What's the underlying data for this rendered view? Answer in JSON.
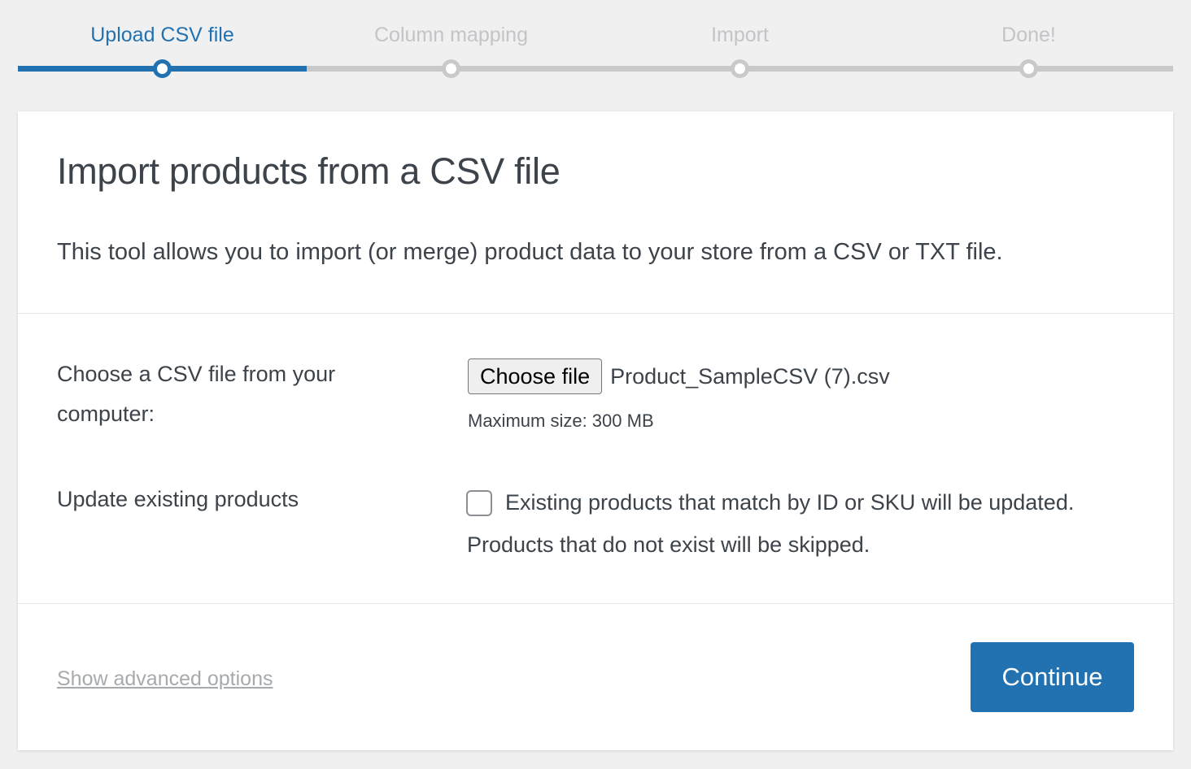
{
  "steps": [
    {
      "label": "Upload CSV file",
      "state": "active"
    },
    {
      "label": "Column mapping",
      "state": "pending"
    },
    {
      "label": "Import",
      "state": "pending"
    },
    {
      "label": "Done!",
      "state": "pending"
    }
  ],
  "progress": {
    "completed_fraction": 0.25
  },
  "header": {
    "title": "Import products from a CSV file",
    "description": "This tool allows you to import (or merge) product data to your store from a CSV or TXT file."
  },
  "file_field": {
    "label": "Choose a CSV file from your computer:",
    "button_label": "Choose file",
    "file_name": "Product_SampleCSV (7).csv",
    "hint": "Maximum size: 300 MB"
  },
  "update_field": {
    "label": "Update existing products",
    "checked": false,
    "description_line1": "Existing products that match by ID or SKU will be updated.",
    "description_line2": "Products that do not exist will be skipped."
  },
  "footer": {
    "advanced_link": "Show advanced options",
    "continue_label": "Continue"
  },
  "colors": {
    "accent": "#2271b1",
    "inactive": "#c3c4c7",
    "track": "#c9c9c9",
    "background": "#f0f0f1"
  }
}
